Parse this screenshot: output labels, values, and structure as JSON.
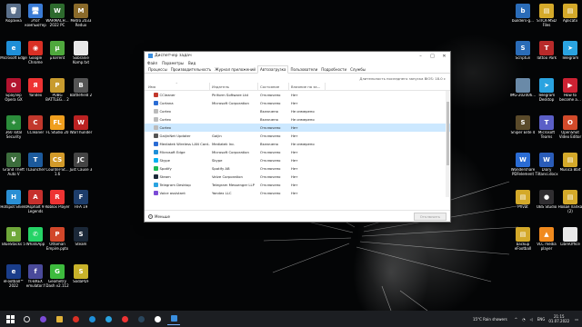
{
  "desktop": {
    "icons_left": [
      {
        "label": "Корзина",
        "color": "#5a6f8a",
        "glyph": "🗑",
        "icon": "recycle-bin-icon"
      },
      {
        "label": "Этот компьютер",
        "color": "#3a7bd5",
        "glyph": "🖥",
        "icon": "computer-icon"
      },
      {
        "label": "WARMACH… 2022 PC",
        "color": "#2d6a2d",
        "glyph": "W",
        "icon": "game-icon"
      },
      {
        "label": "Metro 2033 Redux",
        "color": "#8a6a2a",
        "glyph": "M",
        "icon": "game-icon"
      },
      {
        "label": "Microsoft Edge",
        "color": "#1f8fd8",
        "glyph": "e",
        "icon": "edge-icon"
      },
      {
        "label": "Google Chrome",
        "color": "#d93025",
        "glyph": "◉",
        "icon": "chrome-icon"
      },
      {
        "label": "µTorrent",
        "color": "#4fa83d",
        "glyph": "µ",
        "icon": "torrent-icon"
      },
      {
        "label": "Sobranie Komp.txt",
        "color": "#e8e8e8",
        "glyph": "",
        "icon": "text-file-icon"
      },
      {
        "label": "Браузер Opera GX",
        "color": "#b3132f",
        "glyph": "O",
        "icon": "opera-icon"
      },
      {
        "label": "Yandex",
        "color": "#e33",
        "glyph": "Я",
        "icon": "yandex-icon"
      },
      {
        "label": "PUBG BATTLEG… 2",
        "color": "#c89b2e",
        "glyph": "P",
        "icon": "game-icon"
      },
      {
        "label": "Battlefield 2",
        "color": "#555",
        "glyph": "B",
        "icon": "game-icon"
      },
      {
        "label": "360 Total Security",
        "color": "#2b8d3b",
        "glyph": "+",
        "icon": "antivirus-icon"
      },
      {
        "label": "CCleaner",
        "color": "#c2382c",
        "glyph": "C",
        "icon": "ccleaner-icon"
      },
      {
        "label": "FL Studio 20",
        "color": "#f09f1e",
        "glyph": "FL",
        "icon": "fl-studio-icon"
      },
      {
        "label": "WarThunder",
        "color": "#b22",
        "glyph": "W",
        "icon": "game-icon"
      },
      {
        "label": "Grand Theft Auto V",
        "color": "#3c6d3c",
        "glyph": "V",
        "icon": "game-icon"
      },
      {
        "label": "TLauncher",
        "color": "#1c5a9c",
        "glyph": "T",
        "icon": "launcher-icon"
      },
      {
        "label": "Counter-St… 1.6",
        "color": "#d29a2a",
        "glyph": "CS",
        "icon": "game-icon"
      },
      {
        "label": "Just Cause 3",
        "color": "#444",
        "glyph": "JC",
        "icon": "game-icon"
      },
      {
        "label": "Hotspot Shield",
        "color": "#2a8fd4",
        "glyph": "H",
        "icon": "vpn-icon"
      },
      {
        "label": "Asphalt 9 Legends",
        "color": "#c6302d",
        "glyph": "A",
        "icon": "game-icon"
      },
      {
        "label": "Roblox Player",
        "color": "#e33",
        "glyph": "R",
        "icon": "roblox-icon"
      },
      {
        "label": "FIFA 19",
        "color": "#1d3d6b",
        "glyph": "F",
        "icon": "game-icon"
      },
      {
        "label": "BlueStacks 5",
        "color": "#6fa83a",
        "glyph": "B",
        "icon": "bluestacks-icon"
      },
      {
        "label": "WhatsApp",
        "color": "#25d366",
        "glyph": "✆",
        "icon": "whatsapp-icon"
      },
      {
        "label": "Ottoman Empire.pptx",
        "color": "#d2472a",
        "glyph": "P",
        "icon": "powerpoint-icon"
      },
      {
        "label": "Steam",
        "color": "#1b2838",
        "glyph": "S",
        "icon": "steam-icon"
      },
      {
        "label": "eFootball™ 2022",
        "color": "#1a3d8a",
        "glyph": "e",
        "icon": "game-icon"
      },
      {
        "label": "fs-BREX emulator.f",
        "color": "#4a4a9a",
        "glyph": "f",
        "icon": "file-icon"
      },
      {
        "label": "Geometry Dash v2.112",
        "color": "#3dbb3d",
        "glyph": "G",
        "icon": "game-icon"
      },
      {
        "label": "SodaPDF",
        "color": "#c8b22a",
        "glyph": "S",
        "icon": "pdf-icon"
      }
    ],
    "icons_right": [
      {
        "label": "builders-g…",
        "color": "#2a6cb8",
        "glyph": "b",
        "icon": "file-icon"
      },
      {
        "label": "STICK-MSD Files",
        "color": "#d4a92a",
        "glyph": "▤",
        "icon": "folder-icon"
      },
      {
        "label": "Aplicatii",
        "color": "#d4a92a",
        "glyph": "▤",
        "icon": "folder-icon"
      },
      {
        "label": "Scriptun",
        "color": "#2a6cb8",
        "glyph": "S",
        "icon": "file-icon"
      },
      {
        "label": "Tattoo Park",
        "color": "#b82a2a",
        "glyph": "T",
        "icon": "file-icon"
      },
      {
        "label": "Telegram",
        "color": "#2aa3e0",
        "glyph": "➤",
        "icon": "telegram-icon"
      },
      {
        "label": "IMG-202006…",
        "color": "#6a8aa8",
        "glyph": "",
        "icon": "image-icon"
      },
      {
        "label": "Telegram Desktop",
        "color": "#2aa3e0",
        "glyph": "➤",
        "icon": "telegram-icon"
      },
      {
        "label": "How to become a…",
        "color": "#c23",
        "glyph": "▶",
        "icon": "video-icon"
      },
      {
        "label": "Sniper Elite 4",
        "color": "#5a4a2a",
        "glyph": "S",
        "icon": "game-icon"
      },
      {
        "label": "Microsoft Teams",
        "color": "#5b5fc7",
        "glyph": "T",
        "icon": "teams-icon"
      },
      {
        "label": "OpenShot Video Editor",
        "color": "#d24a2a",
        "glyph": "O",
        "icon": "openshot-icon"
      },
      {
        "label": "Wondershare PDFelement",
        "color": "#2a6cd4",
        "glyph": "W",
        "icon": "pdf-icon"
      },
      {
        "label": "Diary Tiltansi.docx",
        "color": "#2a5cb8",
        "glyph": "W",
        "icon": "word-icon"
      },
      {
        "label": "Musica 8bit",
        "color": "#d4a92a",
        "glyph": "▤",
        "icon": "folder-icon"
      },
      {
        "label": "Privat",
        "color": "#d4a92a",
        "glyph": "▤",
        "icon": "folder-icon"
      },
      {
        "label": "OBS Studio",
        "color": "#302e31",
        "glyph": "●",
        "icon": "obs-icon"
      },
      {
        "label": "Новая папка (2)",
        "color": "#d4a92a",
        "glyph": "▤",
        "icon": "folder-icon"
      },
      {
        "label": "backup eFootball",
        "color": "#d4a92a",
        "glyph": "▤",
        "icon": "folder-icon"
      },
      {
        "label": "VLC media player",
        "color": "#f08a1e",
        "glyph": "▲",
        "icon": "vlc-icon"
      },
      {
        "label": "LibreOffice",
        "color": "#e8e8e8",
        "glyph": "",
        "icon": "libreoffice-icon"
      }
    ]
  },
  "task_manager": {
    "title": "Диспетчер задач",
    "menu": [
      "Файл",
      "Параметры",
      "Вид"
    ],
    "tabs": [
      "Процессы",
      "Производительность",
      "Журнал приложений",
      "Автозагрузка",
      "Пользователи",
      "Подробности",
      "Службы"
    ],
    "active_tab": 3,
    "bios_text": "Длительность последнего запуска BIOS: 18.0 с",
    "columns": [
      "Имя",
      "Издатель",
      "Состояние",
      "Влияние на за…"
    ],
    "rows": [
      {
        "name": "CCleaner",
        "publisher": "Piriform Software Ltd",
        "state": "Отключено",
        "impact": "Нет",
        "color": "#c2382c"
      },
      {
        "name": "Cortana",
        "publisher": "Microsoft Corporation",
        "state": "Отключено",
        "impact": "Нет",
        "color": "#2a6cd4"
      },
      {
        "name": "Cortex",
        "publisher": "",
        "state": "Включено",
        "impact": "Не измерено",
        "color": "#bbbbbb"
      },
      {
        "name": "Cortex",
        "publisher": "",
        "state": "Включено",
        "impact": "Не измерено",
        "color": "#bbbbbb"
      },
      {
        "name": "Cortex",
        "publisher": "",
        "state": "Отключено",
        "impact": "Нет",
        "color": "#bbbbbb"
      },
      {
        "name": "GaijinNet Updater",
        "publisher": "Gaijin",
        "state": "Отключено",
        "impact": "Нет",
        "color": "#555555"
      },
      {
        "name": "Mediatek Wireless LAN Card…",
        "publisher": "Mediatek Inc.",
        "state": "Включено",
        "impact": "Не измерено",
        "color": "#2a6cd4"
      },
      {
        "name": "Microsoft Edge",
        "publisher": "Microsoft Corporation",
        "state": "Отключено",
        "impact": "Нет",
        "color": "#1f8fd8"
      },
      {
        "name": "Skype",
        "publisher": "Skype",
        "state": "Отключено",
        "impact": "Нет",
        "color": "#00aff0"
      },
      {
        "name": "Spotify",
        "publisher": "Spotify AB",
        "state": "Отключено",
        "impact": "Нет",
        "color": "#1db954"
      },
      {
        "name": "Steam",
        "publisher": "Valve Corporation",
        "state": "Отключено",
        "impact": "Нет",
        "color": "#1b2838"
      },
      {
        "name": "Telegram Desktop",
        "publisher": "Telegram Messenger LLP",
        "state": "Отключено",
        "impact": "Нет",
        "color": "#2aa3e0"
      },
      {
        "name": "Voice assistant",
        "publisher": "Yandex LLC",
        "state": "Отключено",
        "impact": "Нет",
        "color": "#7b4bd6"
      }
    ],
    "selected_row": 4,
    "footer_less": "Меньше",
    "disable_button": "Отключить"
  },
  "taskbar": {
    "weather": "15°C  Rain showers",
    "language": "ENG",
    "time": "21:15",
    "date": "01.07.2022"
  }
}
